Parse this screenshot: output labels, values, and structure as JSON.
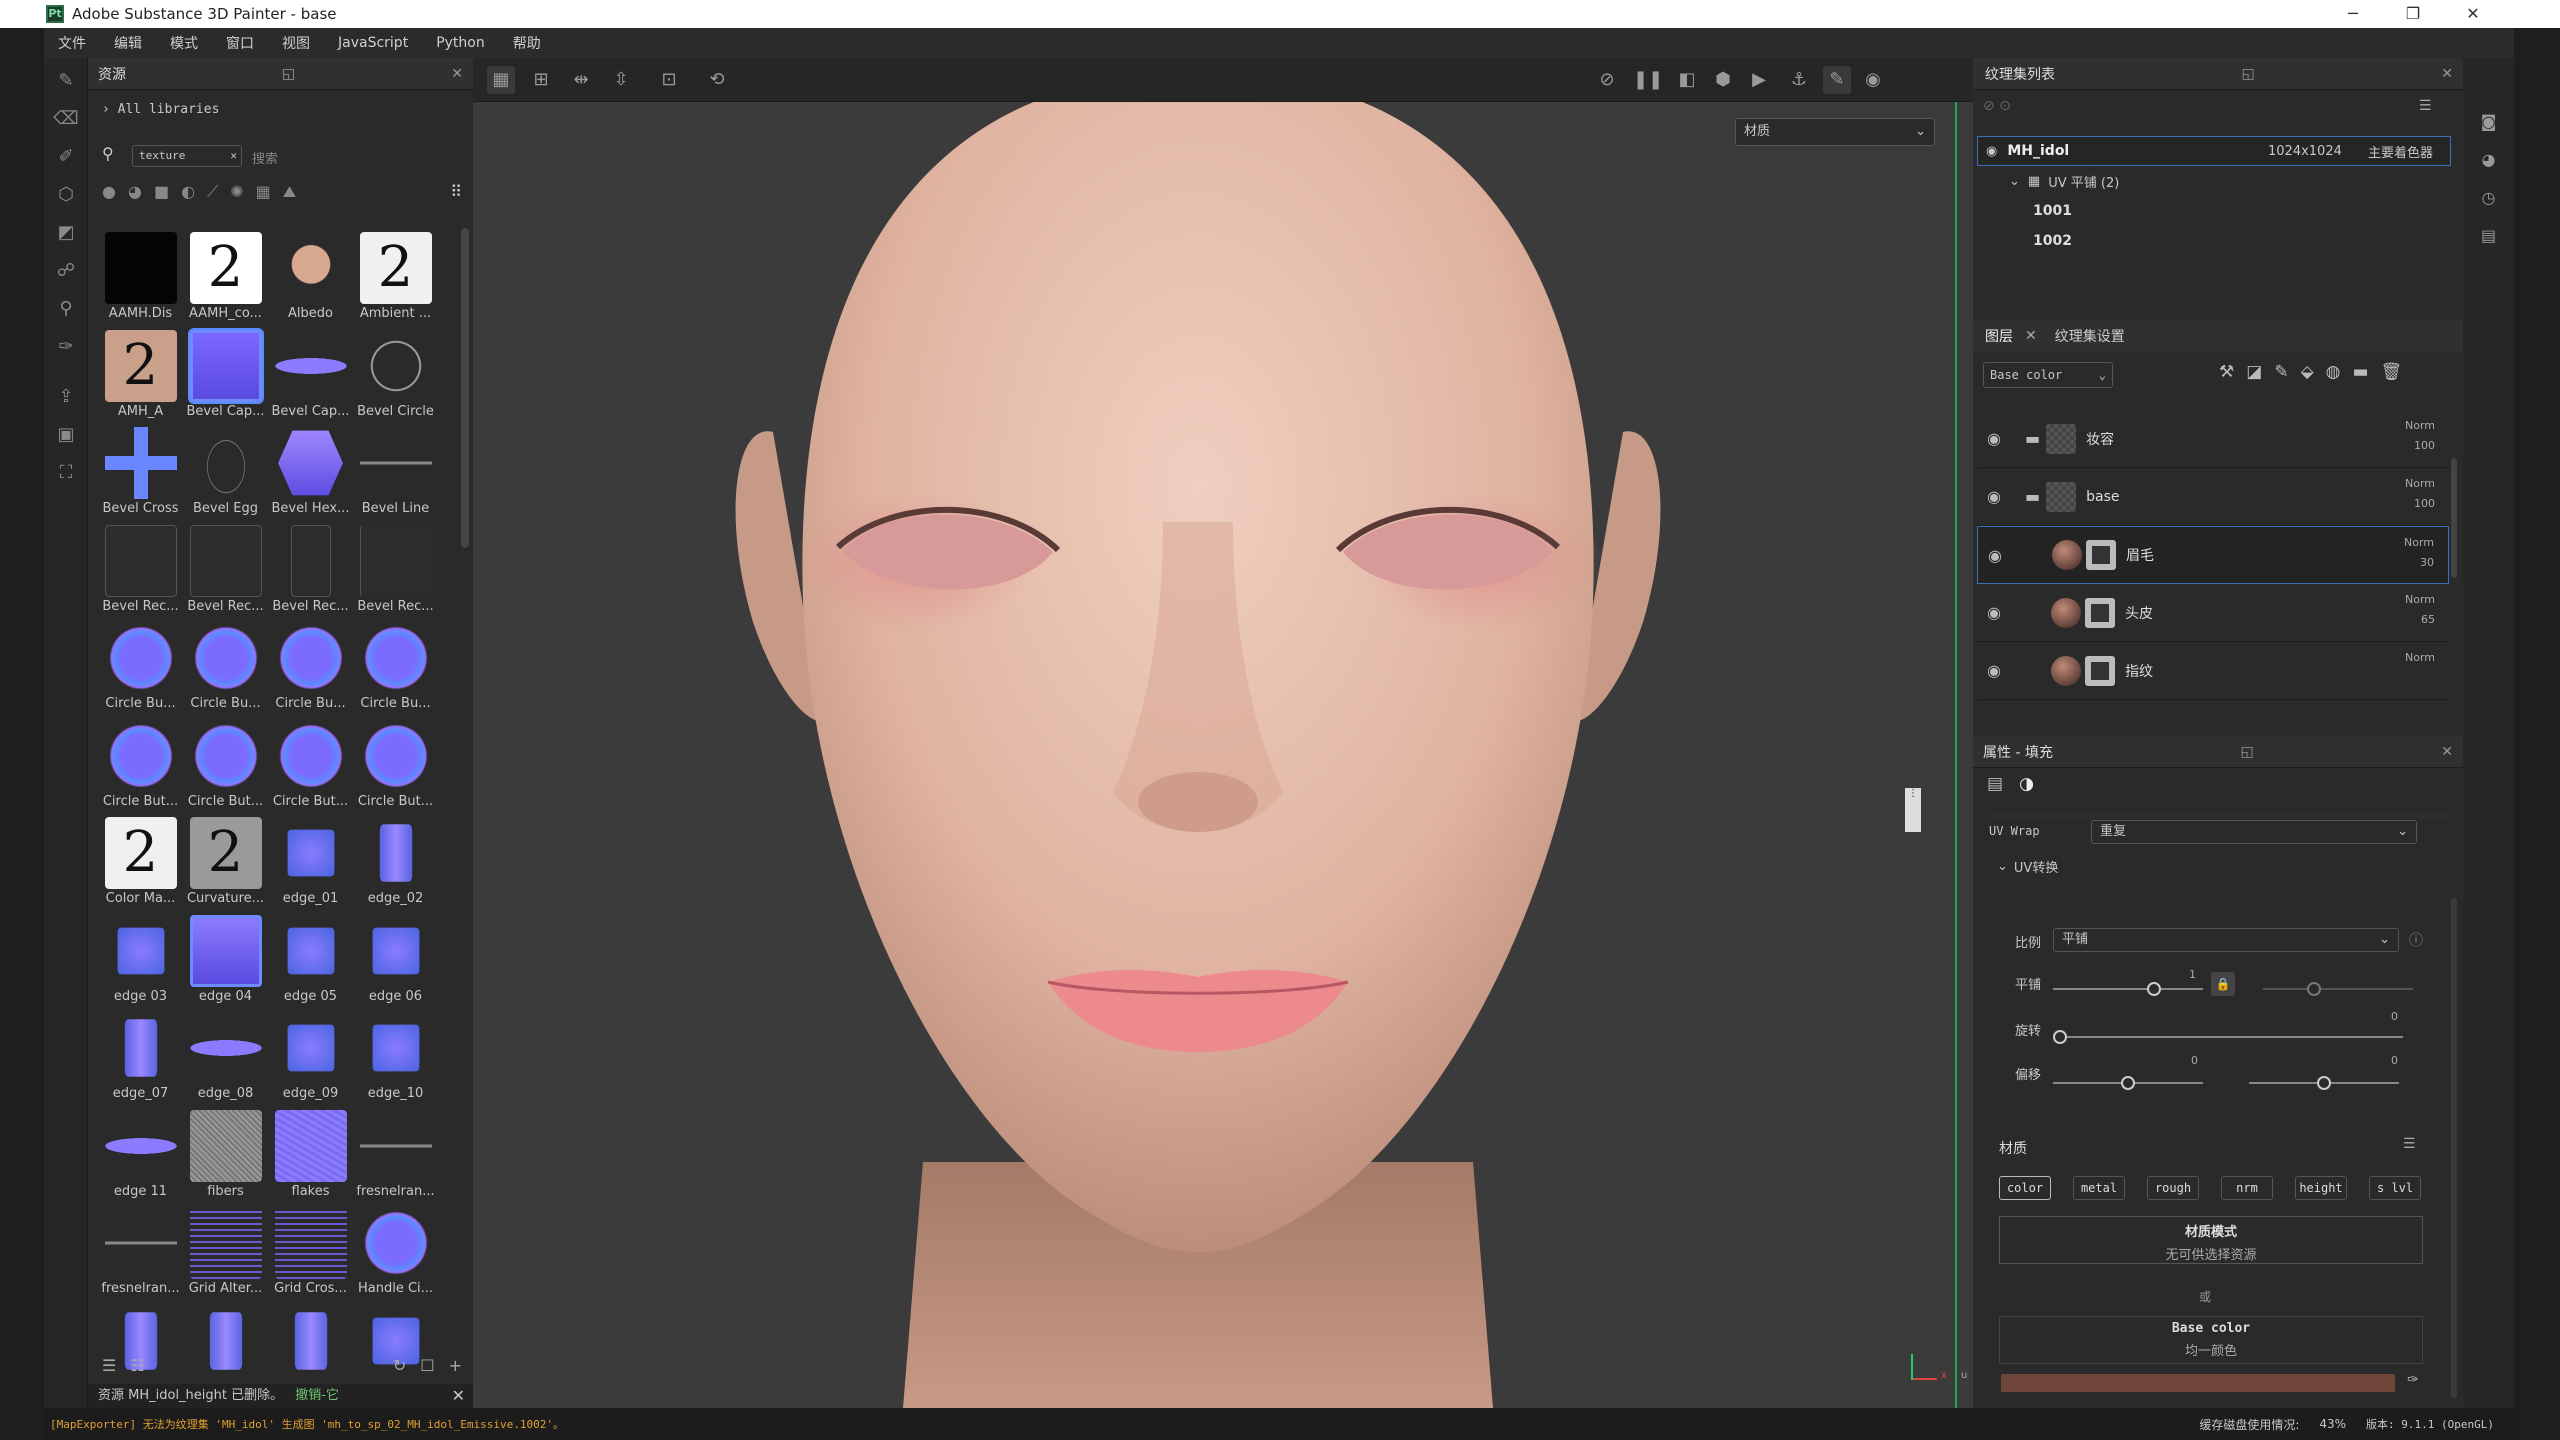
{
  "titlebar": {
    "title": "Adobe Substance 3D Painter - base"
  },
  "menu": [
    "文件",
    "编辑",
    "模式",
    "窗口",
    "视图",
    "JavaScript",
    "Python",
    "帮助"
  ],
  "assets": {
    "title": "资源",
    "breadcrumb": "All libraries",
    "search_value": "texture",
    "search_placeholder": "搜索",
    "items": [
      {
        "label": "AAMH.Dis",
        "kind": "dark"
      },
      {
        "label": "AAMH_co...",
        "kind": "num2"
      },
      {
        "label": "Albedo",
        "kind": "face"
      },
      {
        "label": "Ambient ...",
        "kind": "num2g"
      },
      {
        "label": "AMH_A",
        "kind": "num2s"
      },
      {
        "label": "Bevel Cap...",
        "kind": "capsel"
      },
      {
        "label": "Bevel Cap...",
        "kind": "bar"
      },
      {
        "label": "Bevel Circle",
        "kind": "circle"
      },
      {
        "label": "Bevel Cross",
        "kind": "cross"
      },
      {
        "label": "Bevel Egg",
        "kind": "egg"
      },
      {
        "label": "Bevel Hex...",
        "kind": "hex"
      },
      {
        "label": "Bevel Line",
        "kind": "line"
      },
      {
        "label": "Bevel Rec...",
        "kind": "rect"
      },
      {
        "label": "Bevel Rec...",
        "kind": "rect"
      },
      {
        "label": "Bevel Rec...",
        "kind": "rectv"
      },
      {
        "label": "Bevel Rec...",
        "kind": "rectf"
      },
      {
        "label": "Circle Bu...",
        "kind": "btn"
      },
      {
        "label": "Circle Bu...",
        "kind": "btn"
      },
      {
        "label": "Circle Bu...",
        "kind": "btn"
      },
      {
        "label": "Circle Bu...",
        "kind": "btn"
      },
      {
        "label": "Circle But...",
        "kind": "btn"
      },
      {
        "label": "Circle But...",
        "kind": "btn"
      },
      {
        "label": "Circle But...",
        "kind": "btn"
      },
      {
        "label": "Circle But...",
        "kind": "btn"
      },
      {
        "label": "Color Ma...",
        "kind": "num2g"
      },
      {
        "label": "Curvature...",
        "kind": "num2c"
      },
      {
        "label": "edge_01",
        "kind": "edge"
      },
      {
        "label": "edge_02",
        "kind": "edgev"
      },
      {
        "label": "edge 03",
        "kind": "edge"
      },
      {
        "label": "edge 04",
        "kind": "edgesel"
      },
      {
        "label": "edge 05",
        "kind": "edge"
      },
      {
        "label": "edge 06",
        "kind": "edge"
      },
      {
        "label": "edge_07",
        "kind": "edgev"
      },
      {
        "label": "edge_08",
        "kind": "bar"
      },
      {
        "label": "edge_09",
        "kind": "edge"
      },
      {
        "label": "edge_10",
        "kind": "edge"
      },
      {
        "label": "edge 11",
        "kind": "bar"
      },
      {
        "label": "fibers",
        "kind": "noise"
      },
      {
        "label": "flakes",
        "kind": "flakes"
      },
      {
        "label": "fresnelran...",
        "kind": "line"
      },
      {
        "label": "fresnelran...",
        "kind": "line"
      },
      {
        "label": "Grid Alter...",
        "kind": "gridp"
      },
      {
        "label": "Grid Cros...",
        "kind": "gridp"
      },
      {
        "label": "Handle Ci...",
        "kind": "btn"
      },
      {
        "label": "",
        "kind": "edgev"
      },
      {
        "label": "",
        "kind": "edgev"
      },
      {
        "label": "",
        "kind": "edgev"
      },
      {
        "label": "",
        "kind": "edge"
      }
    ],
    "footer_log": "资源 MH_idol_height 已删除。",
    "footer_undo": "撤销-它"
  },
  "viewport": {
    "material_dropdown": "材质",
    "axis_x": "x",
    "axis_u": "u"
  },
  "texture_set": {
    "title": "纹理集列表",
    "set_name": "MH_idol",
    "resolution": "1024x1024",
    "shader": "主要着色器",
    "uv_group": "UV 平铺 (2)",
    "tiles": [
      "1001",
      "1002"
    ]
  },
  "layers": {
    "tab_layers": "图层",
    "tab_settings": "纹理集设置",
    "channel": "Base color",
    "items": [
      {
        "name": "妆容",
        "blend": "Norm",
        "opacity": "100",
        "type": "folder"
      },
      {
        "name": "base",
        "blend": "Norm",
        "opacity": "100",
        "type": "folder"
      },
      {
        "name": "眉毛",
        "blend": "Norm",
        "opacity": "30",
        "type": "fill",
        "selected": true
      },
      {
        "name": "头皮",
        "blend": "Norm",
        "opacity": "65",
        "type": "fill"
      },
      {
        "name": "指纹",
        "blend": "Norm",
        "opacity": "",
        "type": "fill"
      }
    ]
  },
  "properties": {
    "title": "属性 - 填充",
    "uv_wrap_label": "UV Wrap",
    "uv_wrap_value": "重复",
    "uv_transform": "UV转换",
    "scale_label": "比例",
    "scale_value": "平铺",
    "tile_label": "平铺",
    "tile_value": "1",
    "rotate_label": "旋转",
    "rotate_value": "0",
    "offset_label": "偏移",
    "offset_u": "0",
    "offset_v": "0",
    "material_section": "材质",
    "channels": [
      "color",
      "metal",
      "rough",
      "nrm",
      "height",
      "s lvl"
    ],
    "mode_title": "材质模式",
    "mode_sub": "无可供选择资源",
    "or": "或",
    "basecolor_title": "Base color",
    "basecolor_sub": "均一颜色",
    "basecolor_hex": "#6e4538"
  },
  "status": {
    "log": "[MapExporter] 无法为纹理集 'MH_idol' 生成图 'mh_to_sp_02_MH_idol_Emissive.1002'。",
    "cache": "缓存磁盘使用情况:",
    "cache_pct": "43%",
    "version": "版本: 9.1.1 (OpenGL)"
  }
}
